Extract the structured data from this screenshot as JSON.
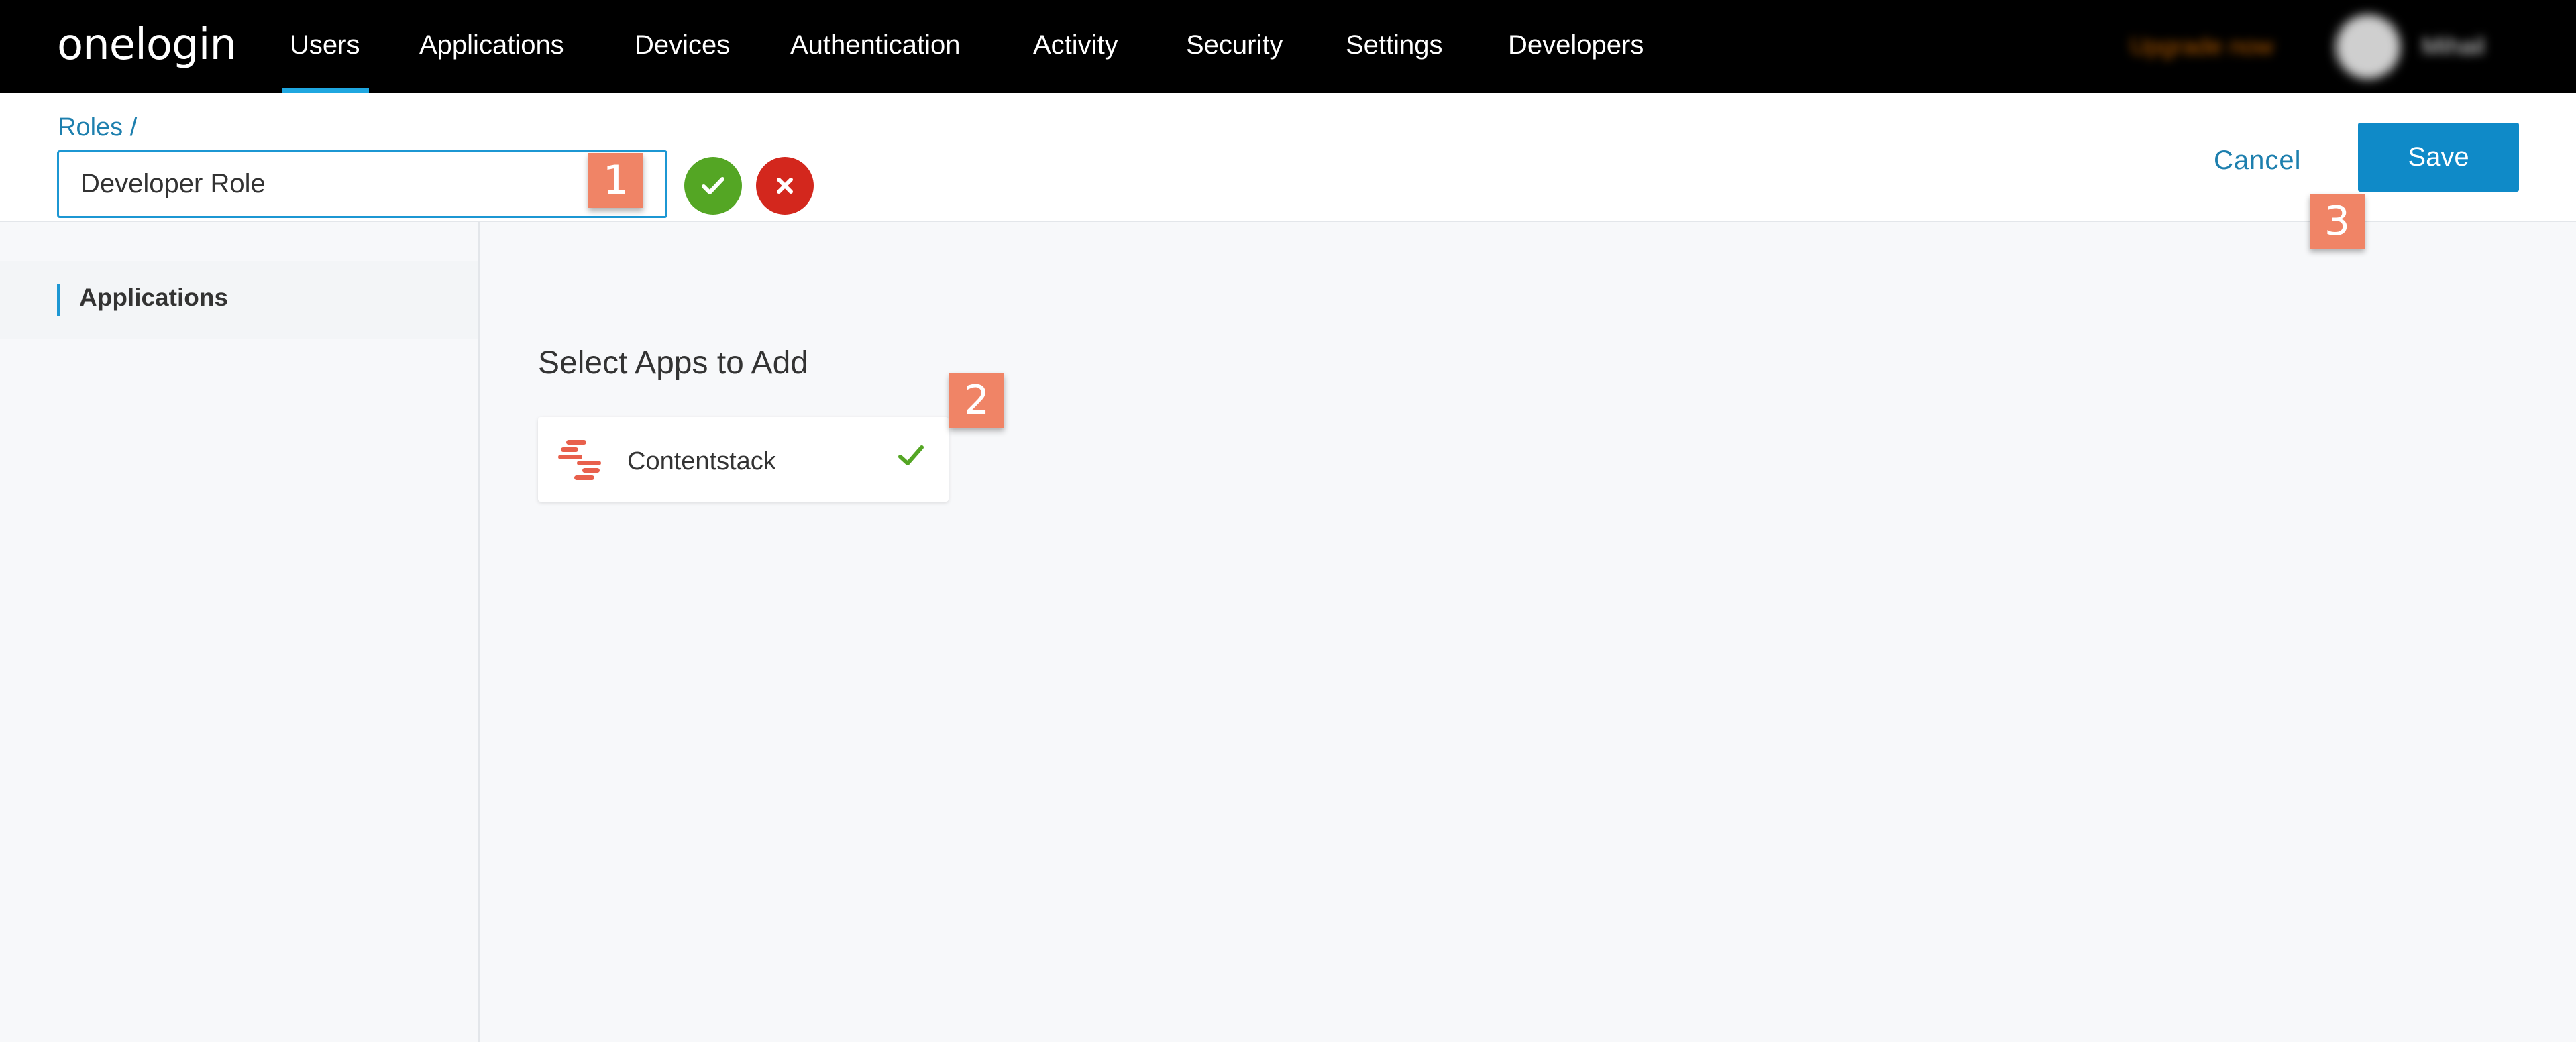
{
  "nav": {
    "logo": "onelogin",
    "items": [
      "Users",
      "Applications",
      "Devices",
      "Authentication",
      "Activity",
      "Security",
      "Settings",
      "Developers"
    ],
    "active": "Users",
    "upgrade": "Upgrade now",
    "username": "Mihail"
  },
  "header": {
    "breadcrumb": "Roles /",
    "role_name": "Developer Role",
    "cancel_label": "Cancel",
    "save_label": "Save"
  },
  "sidebar": {
    "items": [
      {
        "label": "Applications"
      }
    ]
  },
  "main": {
    "section_title": "Select Apps to Add",
    "apps": [
      {
        "name": "Contentstack",
        "selected": true
      }
    ]
  },
  "badges": [
    "1",
    "2",
    "3"
  ],
  "colors": {
    "nav_bg": "#000000",
    "accent": "#1c97d3",
    "save_button": "#0f8ac8",
    "confirm": "#54a624",
    "reject": "#d3271d",
    "badge": "#f08466"
  },
  "icons": {
    "confirm": "check-icon",
    "reject": "close-icon",
    "app_logo": "contentstack-logo-icon",
    "selected": "check-icon"
  }
}
